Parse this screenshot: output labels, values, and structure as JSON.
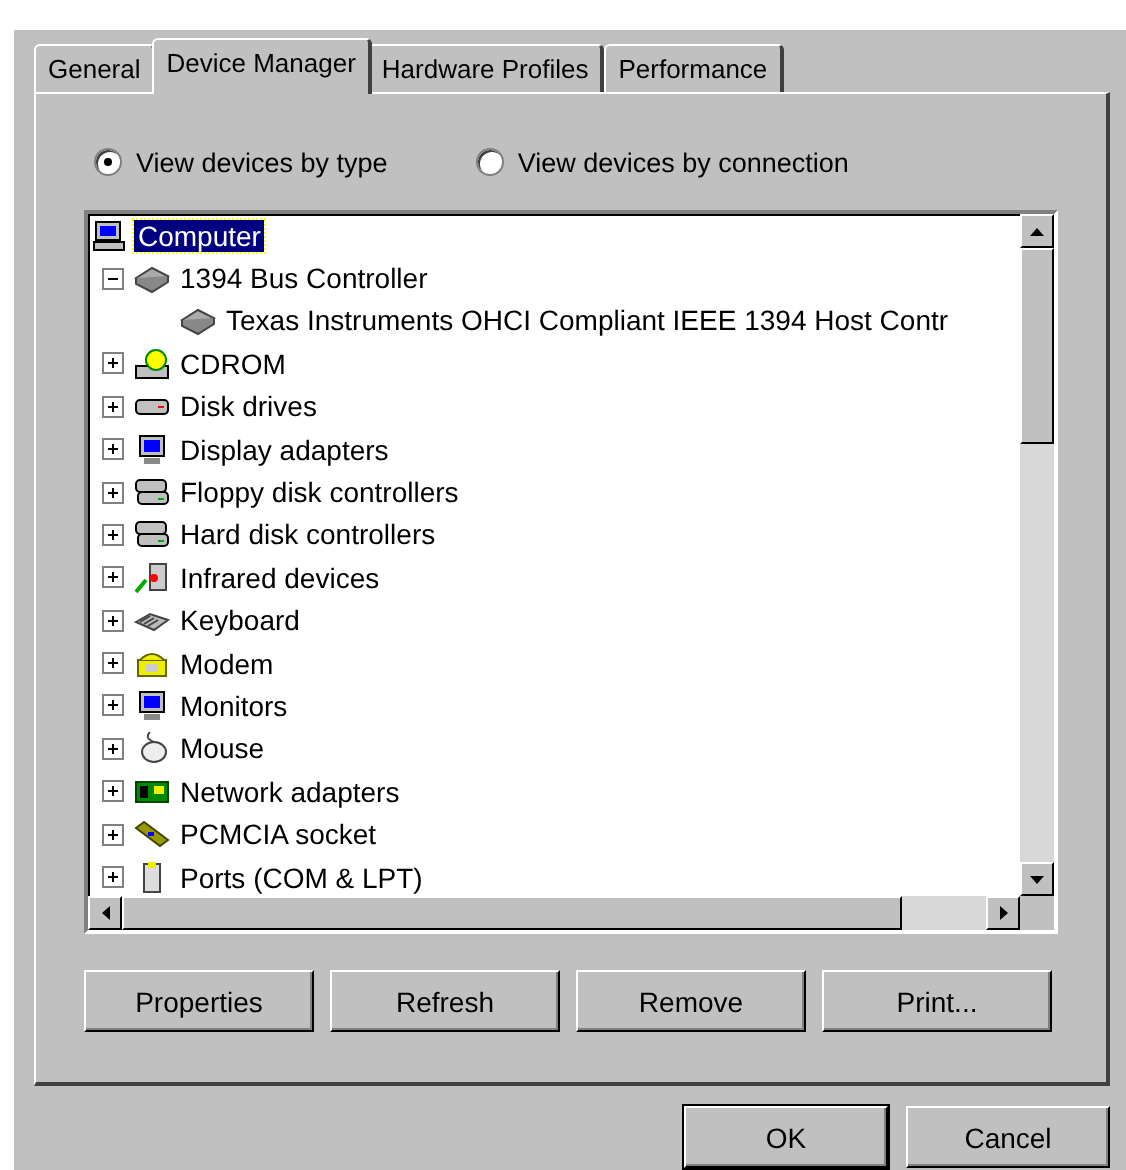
{
  "tabs": [
    {
      "label": "General",
      "selected": false
    },
    {
      "label": "Device Manager",
      "selected": true
    },
    {
      "label": "Hardware Profiles",
      "selected": false
    },
    {
      "label": "Performance",
      "selected": false
    }
  ],
  "view_options": [
    {
      "label": "View devices by type",
      "selected": true
    },
    {
      "label": "View devices by connection",
      "selected": false
    }
  ],
  "device_tree": {
    "label": "Computer",
    "selected": true,
    "children": [
      {
        "label": "1394 Bus Controller",
        "selected": false,
        "expanded": true,
        "children": [
          {
            "label": "Texas Instruments OHCI Compliant IEEE 1394 Host Contr",
            "selected": false
          }
        ]
      },
      {
        "label": "CDROM",
        "selected": false,
        "expanded": false
      },
      {
        "label": "Disk drives",
        "selected": false,
        "expanded": false
      },
      {
        "label": "Display adapters",
        "selected": false,
        "expanded": false
      },
      {
        "label": "Floppy disk controllers",
        "selected": false,
        "expanded": false
      },
      {
        "label": "Hard disk controllers",
        "selected": false,
        "expanded": false
      },
      {
        "label": "Infrared devices",
        "selected": false,
        "expanded": false
      },
      {
        "label": "Keyboard",
        "selected": false,
        "expanded": false
      },
      {
        "label": "Modem",
        "selected": false,
        "expanded": false
      },
      {
        "label": "Monitors",
        "selected": false,
        "expanded": false
      },
      {
        "label": "Mouse",
        "selected": false,
        "expanded": false
      },
      {
        "label": "Network adapters",
        "selected": false,
        "expanded": false
      },
      {
        "label": "PCMCIA socket",
        "selected": false,
        "expanded": false
      },
      {
        "label": "Ports (COM & LPT)",
        "selected": false,
        "expanded": false
      }
    ]
  },
  "action_buttons": [
    "Properties",
    "Refresh",
    "Remove",
    "Print..."
  ],
  "dialog_buttons": [
    "OK",
    "Cancel"
  ]
}
